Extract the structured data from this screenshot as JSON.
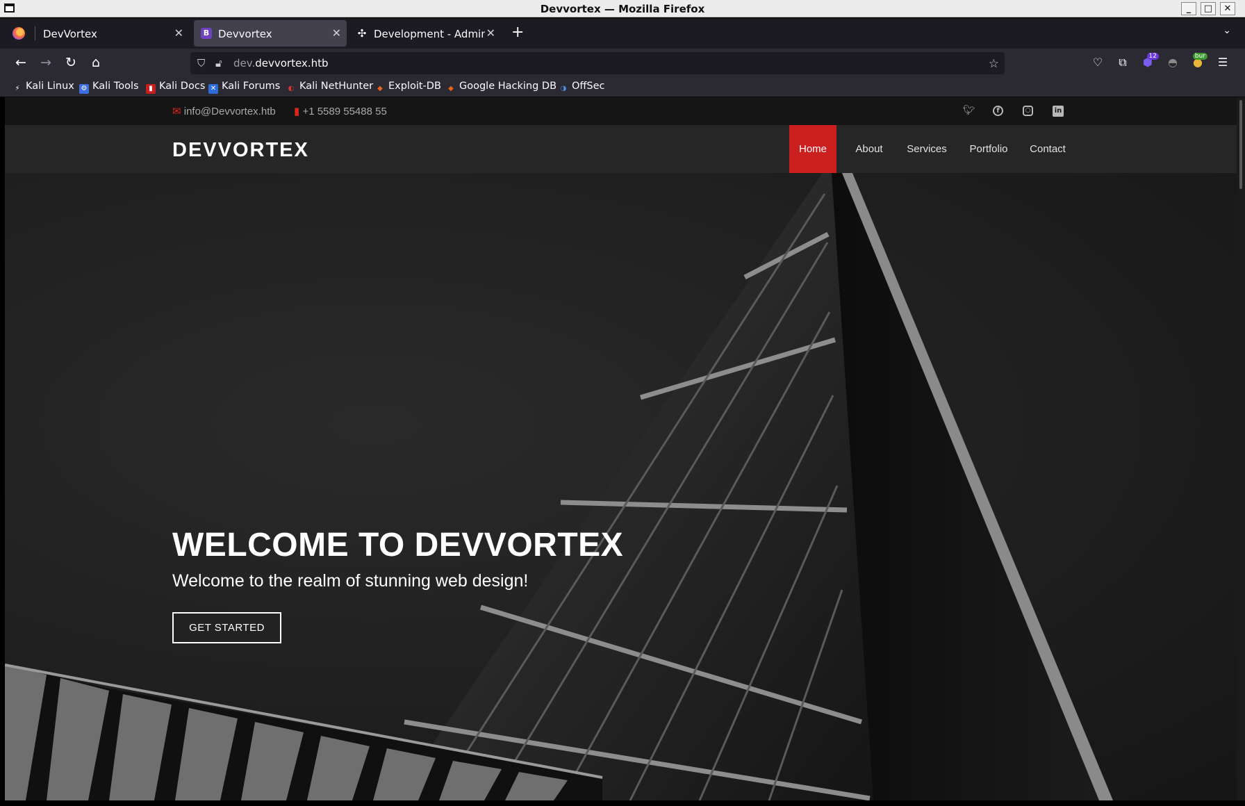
{
  "window": {
    "title": "Devvortex — Mozilla Firefox"
  },
  "tabs": [
    {
      "label": "DevVortex",
      "active": false
    },
    {
      "label": "Devvortex",
      "favicon": "B",
      "active": true
    },
    {
      "label": "Development - Administr",
      "active": false
    }
  ],
  "navbar": {
    "url_host_prefix": "dev.",
    "url_domain": "devvortex.htb",
    "extension_badge": "12",
    "burp_label": "bur"
  },
  "bookmarks": [
    {
      "label": "Kali Linux"
    },
    {
      "label": "Kali Tools"
    },
    {
      "label": "Kali Docs"
    },
    {
      "label": "Kali Forums"
    },
    {
      "label": "Kali NetHunter"
    },
    {
      "label": "Exploit-DB"
    },
    {
      "label": "Google Hacking DB"
    },
    {
      "label": "OffSec"
    }
  ],
  "site": {
    "topbar": {
      "email": "info@Devvortex.htb",
      "phone": "+1 5589 55488 55"
    },
    "logo": "DEVVORTEX",
    "menu": [
      {
        "label": "Home",
        "active": true
      },
      {
        "label": "About"
      },
      {
        "label": "Services"
      },
      {
        "label": "Portfolio"
      },
      {
        "label": "Contact"
      }
    ],
    "hero": {
      "title": "WELCOME TO DEVVORTEX",
      "subtitle": "Welcome to the realm of stunning web design!",
      "cta": "GET STARTED"
    }
  },
  "colors": {
    "accent": "#cc1f1f",
    "tab_active": "#42414d",
    "toolbar": "#2b2a33"
  }
}
